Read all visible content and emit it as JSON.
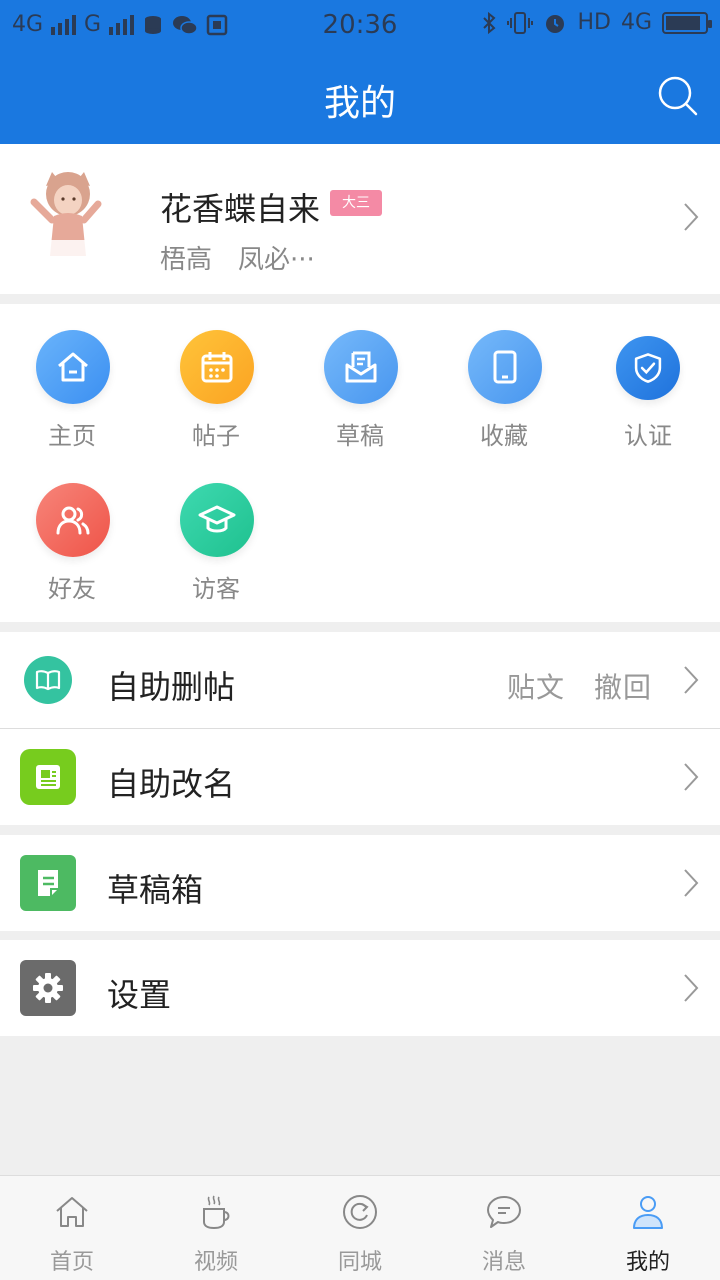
{
  "status_bar": {
    "network_left": "4G",
    "network_mid": "G",
    "time": "20:36",
    "hd": "HD",
    "network_right": "4G"
  },
  "header": {
    "title": "我的"
  },
  "profile": {
    "name": "花香蝶自来",
    "badge": "大三",
    "forums": "梧高　凤必···"
  },
  "grid": [
    {
      "label": "主页",
      "icon": "home-icon",
      "color": "#4a9cf5"
    },
    {
      "label": "帖子",
      "icon": "calendar-icon",
      "color": "#fbb32a"
    },
    {
      "label": "草稿",
      "icon": "draft-icon",
      "color": "#5aa5f0"
    },
    {
      "label": "收藏",
      "icon": "tablet-icon",
      "color": "#5aa5f0"
    },
    {
      "label": "认证",
      "icon": "shield-check-icon",
      "color": "#2f86e8"
    },
    {
      "label": "好友",
      "icon": "friends-icon",
      "color": "#f36b5e"
    },
    {
      "label": "访客",
      "icon": "graduation-cap-icon",
      "color": "#2ed0a2"
    }
  ],
  "rows": [
    {
      "label": "自助删帖",
      "extra": "贴文　撤回",
      "icon": "book-icon",
      "color": "#34c3a0"
    },
    {
      "label": "自助改名",
      "extra": "",
      "icon": "id-card-icon",
      "color": "#77cc1e"
    },
    {
      "label": "草稿箱",
      "extra": "",
      "icon": "document-icon",
      "color": "#4dba62"
    },
    {
      "label": "设置",
      "extra": "",
      "icon": "gear-icon",
      "color": "#6b6b6b"
    }
  ],
  "tabs": [
    {
      "label": "首页",
      "icon": "home-outline-icon"
    },
    {
      "label": "视频",
      "icon": "coffee-cup-icon"
    },
    {
      "label": "同城",
      "icon": "refresh-circle-icon"
    },
    {
      "label": "消息",
      "icon": "chat-bubble-icon"
    },
    {
      "label": "我的",
      "icon": "user-icon"
    }
  ],
  "colors": {
    "header_bg": "#1a78e0",
    "active_tab": "#222222",
    "inactive_tab": "#999999"
  }
}
